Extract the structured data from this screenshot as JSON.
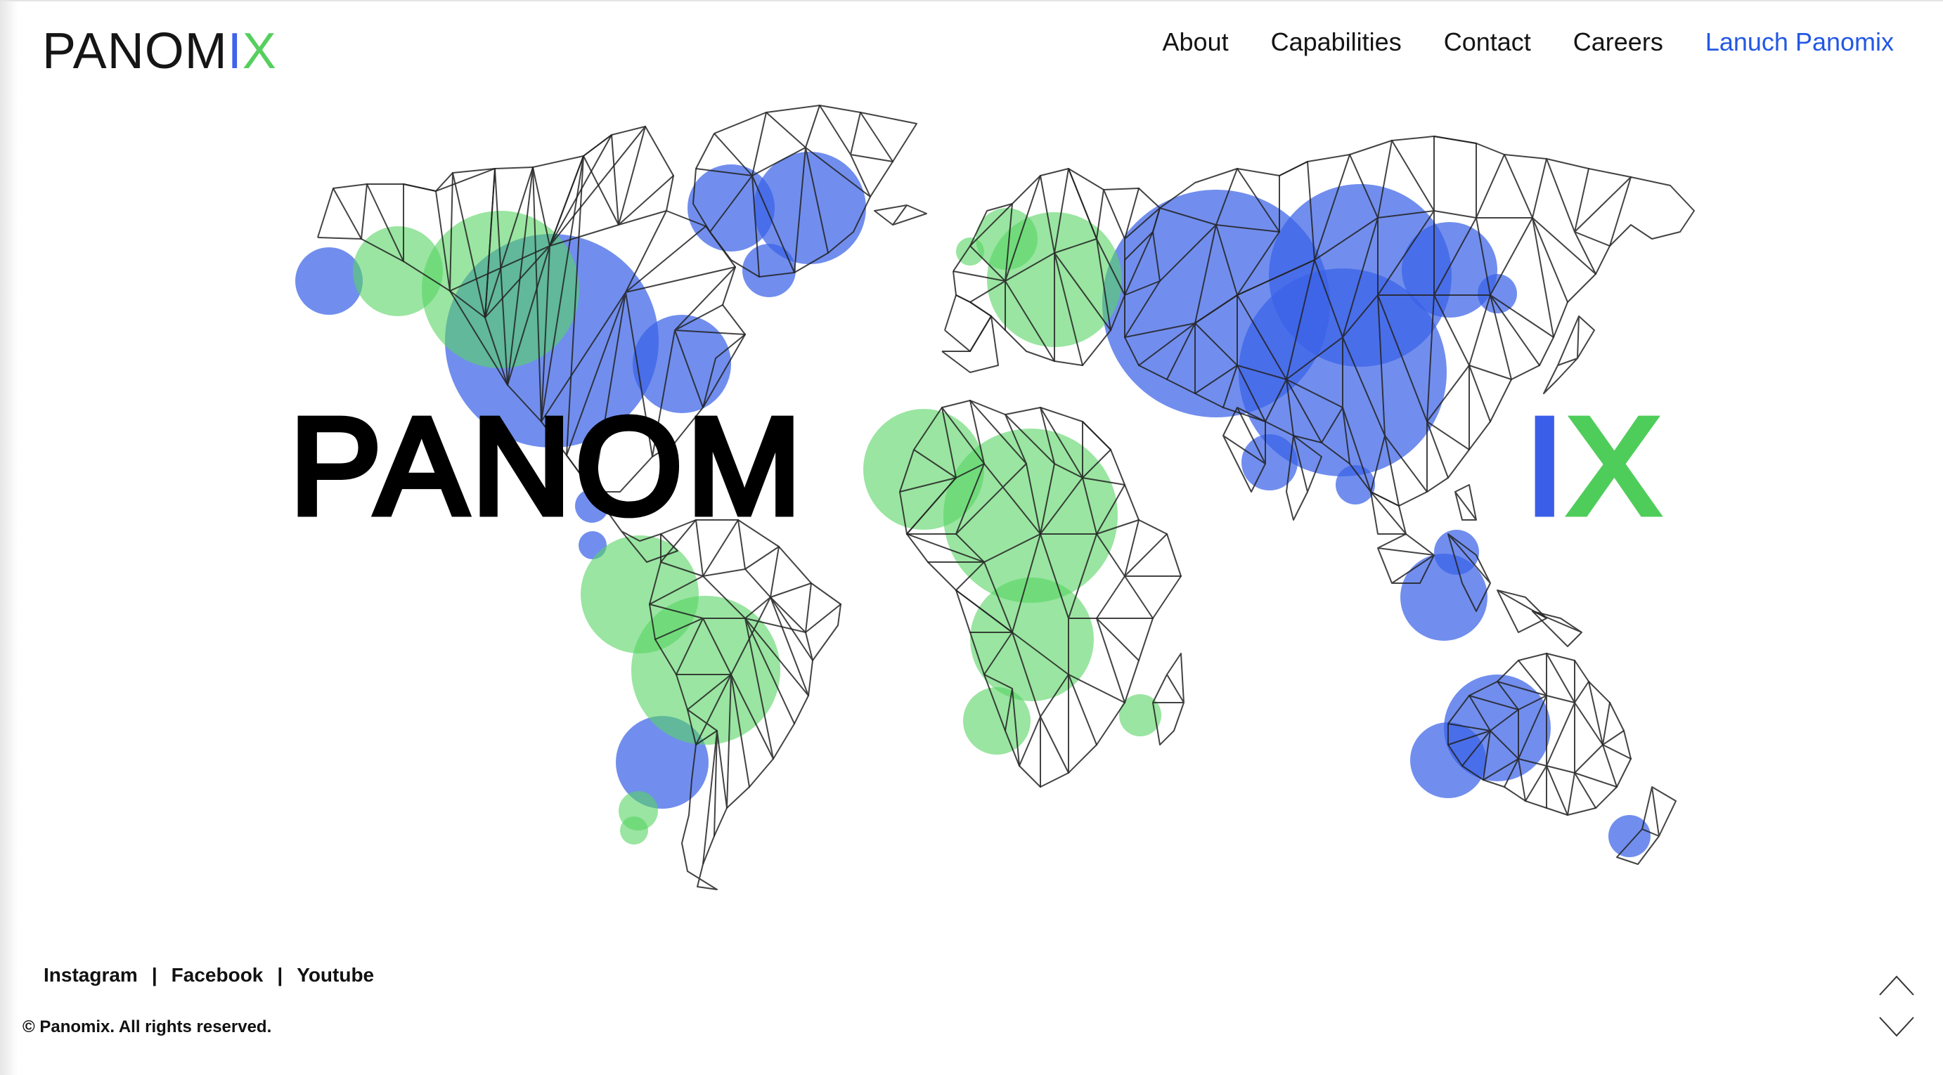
{
  "header": {
    "logo": {
      "part1": "PANOM",
      "part2": "I",
      "part3": "X"
    },
    "nav": [
      {
        "label": "About"
      },
      {
        "label": "Capabilities"
      },
      {
        "label": "Contact"
      },
      {
        "label": "Careers"
      },
      {
        "label": "Lanuch Panomix"
      }
    ]
  },
  "hero": {
    "word_left": "PANOM",
    "word_right_i": "I",
    "word_right_x": "X"
  },
  "footer": {
    "social": [
      {
        "label": "Instagram"
      },
      {
        "label": "Facebook"
      },
      {
        "label": "Youtube"
      }
    ],
    "separator": "|",
    "copyright": "© Panomix. All rights reserved."
  },
  "icons": {
    "scroll_up": "chevron-up-icon",
    "scroll_down": "chevron-down-icon"
  },
  "colors": {
    "brand_blue": "#3f63ea",
    "brand_green": "#55cf5d",
    "link_blue": "#2358e4",
    "text_dark": "#141414"
  }
}
